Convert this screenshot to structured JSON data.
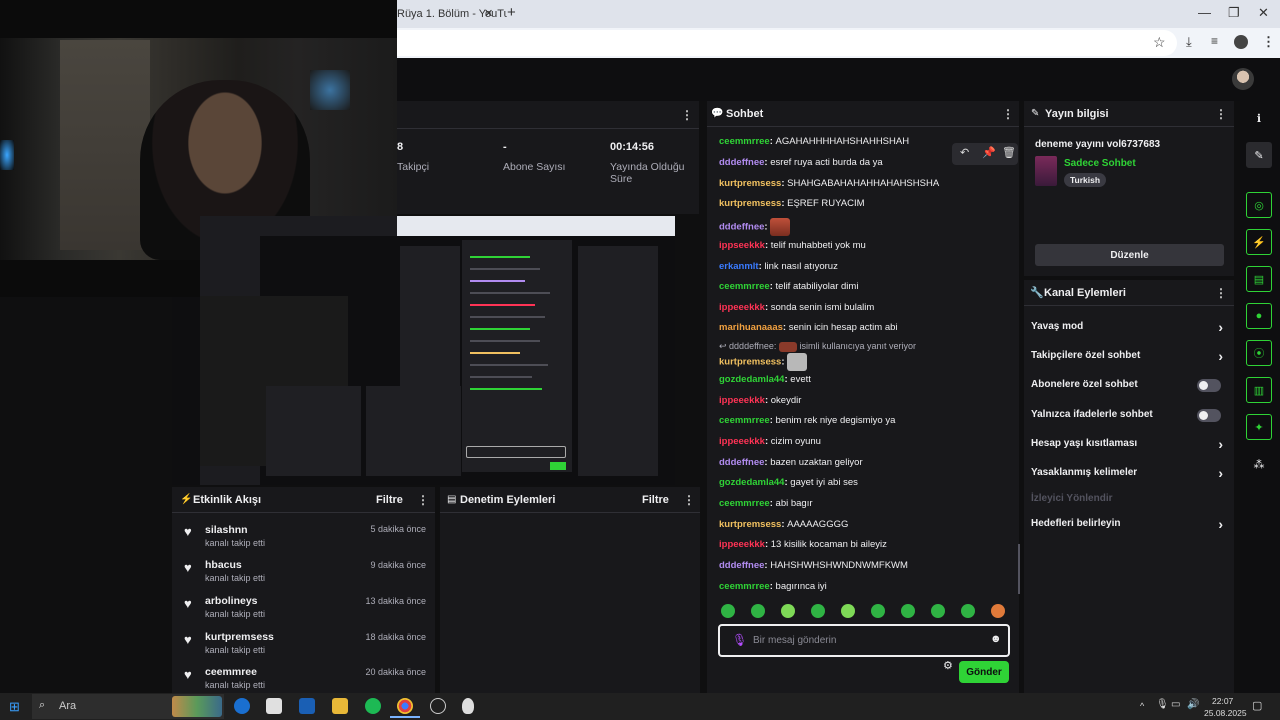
{
  "browser": {
    "tab_title": "Rüya 1. Bölüm - YouTu",
    "close_tab": "✕",
    "new_tab": "+",
    "win_min": "—",
    "win_restore": "❐",
    "win_close": "✕"
  },
  "stats": [
    {
      "value": "8",
      "label": "Takipçi"
    },
    {
      "value": "-",
      "label": "Abone Sayısı"
    },
    {
      "value": "00:14:56",
      "label": "Yayında Olduğu Süre"
    }
  ],
  "events_panel": {
    "title": "Etkinlik Akışı",
    "filter": "Filtre",
    "items": [
      {
        "name": "silashnn",
        "sub": "kanalı takip etti",
        "time": "5 dakika önce"
      },
      {
        "name": "hbacus",
        "sub": "kanalı takip etti",
        "time": "9 dakika önce"
      },
      {
        "name": "arbolineys",
        "sub": "kanalı takip etti",
        "time": "13 dakika önce"
      },
      {
        "name": "kurtpremsess",
        "sub": "kanalı takip etti",
        "time": "18 dakika önce"
      },
      {
        "name": "ceemmree",
        "sub": "kanalı takip etti",
        "time": "20 dakika önce"
      }
    ]
  },
  "moderation_panel": {
    "title": "Denetim Eylemleri",
    "filter": "Filtre"
  },
  "chat": {
    "title": "Sohbet",
    "reply_note": "ddddeffnee:",
    "reply_note_rest": "isimli kullanıcıya yanıt veriyor",
    "messages": [
      {
        "user": "ceemmrree",
        "color": "#2fd336",
        "text": "AGAHAHHHHAHSHAHHSHAH"
      },
      {
        "user": "dddeffnee",
        "color": "#b18bf0",
        "text": "esref ruya acti burda da ya"
      },
      {
        "user": "kurtpremsess",
        "color": "#f0c060",
        "text": "SHAHGABAHAHAHHAHAHSHSHA"
      },
      {
        "user": "kurtpremsess",
        "color": "#f0c060",
        "text": "EŞREF RUYACIM"
      },
      {
        "user": "dddeffnee",
        "color": "#b18bf0",
        "text": ""
      },
      {
        "user": "ippseekkk",
        "color": "#ff3355",
        "text": "telif muhabbeti yok mu"
      },
      {
        "user": "erkanmlt",
        "color": "#3a7bff",
        "text": "link nasıl atıyoruz"
      },
      {
        "user": "ceemmrree",
        "color": "#2fd336",
        "text": "telif atabiliyolar dimi"
      },
      {
        "user": "ippeeekkk",
        "color": "#ff3355",
        "text": "sonda senin ismi bulalim"
      },
      {
        "user": "marihuanaaas",
        "color": "#f0a040",
        "text": "senin icin hesap actim abi"
      },
      {
        "user": "kurtpremsess",
        "color": "#f0c060",
        "text": ""
      },
      {
        "user": "gozdedamla44",
        "color": "#2fd336",
        "text": "evett"
      },
      {
        "user": "ippeeekkk",
        "color": "#ff3355",
        "text": "okeydir"
      },
      {
        "user": "ceemmrree",
        "color": "#2fd336",
        "text": "benim rek niye degismiyo ya"
      },
      {
        "user": "ippeeekkk",
        "color": "#ff3355",
        "text": "cizim oyunu"
      },
      {
        "user": "dddeffnee",
        "color": "#b18bf0",
        "text": "bazen uzaktan geliyor"
      },
      {
        "user": "gozdedamla44",
        "color": "#2fd336",
        "text": "gayet iyi abi ses"
      },
      {
        "user": "ceemmrree",
        "color": "#2fd336",
        "text": "abi bagır"
      },
      {
        "user": "kurtpremsess",
        "color": "#f0c060",
        "text": "AAAAAGGGG"
      },
      {
        "user": "ippeeekkk",
        "color": "#ff3355",
        "text": "13 kisilik kocaman bi aileyiz"
      },
      {
        "user": "dddeffnee",
        "color": "#b18bf0",
        "text": "HAHSHWHSHWNDNWMFKWM"
      },
      {
        "user": "ceemmrree",
        "color": "#2fd336",
        "text": "bagırınca iyi"
      }
    ],
    "input_placeholder": "Bir mesaj gönderin",
    "send_label": "Gönder"
  },
  "stream_info": {
    "title": "Yayın bilgisi",
    "stream_title": "deneme yayını vol6737683",
    "category": "Sadece Sohbet",
    "language": "Turkish",
    "edit_label": "Düzenle"
  },
  "channel_actions": {
    "title": "Kanal Eylemleri",
    "items": [
      {
        "label": "Yavaş mod",
        "control": "chevron"
      },
      {
        "label": "Takipçilere özel sohbet",
        "control": "chevron"
      },
      {
        "label": "Abonelere özel sohbet",
        "control": "toggle"
      },
      {
        "label": "Yalnızca ifadelerle sohbet",
        "control": "toggle"
      },
      {
        "label": "Hesap yaşı kısıtlaması",
        "control": "chevron"
      },
      {
        "label": "Yasaklanmış kelimeler",
        "control": "chevron"
      },
      {
        "label": "İzleyici Yönlendir",
        "control": "disabled"
      },
      {
        "label": "Hedefleri belirleyin",
        "control": "chevron"
      }
    ]
  },
  "taskbar": {
    "search_label": "Ara",
    "time": "22:07",
    "date": "25.08.2025"
  },
  "colors": {
    "accent": "#2fd336",
    "panel": "#18181b",
    "bg": "#0e0e10"
  }
}
